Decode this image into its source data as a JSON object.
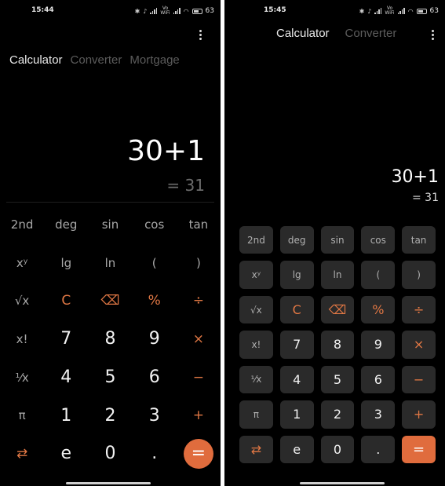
{
  "left": {
    "status": {
      "time": "15:44",
      "battery": "63"
    },
    "tabs": [
      "Calculator",
      "Converter",
      "Mortgage"
    ],
    "active_tab": 0,
    "display": {
      "expression": "30+1",
      "result": "= 31"
    },
    "keys": [
      [
        "2nd",
        "deg",
        "sin",
        "cos",
        "tan"
      ],
      [
        "xʸ",
        "lg",
        "ln",
        "(",
        ")"
      ],
      [
        "√x",
        "C",
        "⌫",
        "%",
        "÷"
      ],
      [
        "x!",
        "7",
        "8",
        "9",
        "×"
      ],
      [
        "¹⁄x",
        "4",
        "5",
        "6",
        "−"
      ],
      [
        "π",
        "1",
        "2",
        "3",
        "+"
      ],
      [
        "⇄",
        "e",
        "0",
        ".",
        "="
      ]
    ]
  },
  "right": {
    "status": {
      "time": "15:45",
      "battery": "63"
    },
    "tabs": [
      "Calculator",
      "Converter"
    ],
    "active_tab": 0,
    "display": {
      "expression": "30+1",
      "result": "= 31"
    },
    "keys": [
      [
        "2nd",
        "deg",
        "sin",
        "cos",
        "tan"
      ],
      [
        "xʸ",
        "lg",
        "ln",
        "(",
        ")"
      ],
      [
        "√x",
        "C",
        "⌫",
        "%",
        "÷"
      ],
      [
        "x!",
        "7",
        "8",
        "9",
        "×"
      ],
      [
        "¹⁄x",
        "4",
        "5",
        "6",
        "−"
      ],
      [
        "π",
        "1",
        "2",
        "3",
        "+"
      ],
      [
        "⇄",
        "e",
        "0",
        ".",
        "="
      ]
    ]
  },
  "colors": {
    "accent": "#e06c3d",
    "background": "#000000",
    "key_bg": "#2a2a2a"
  }
}
